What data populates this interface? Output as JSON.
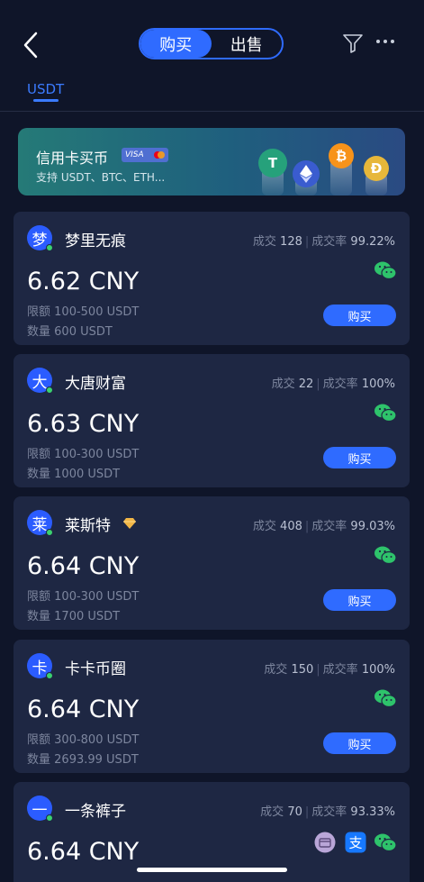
{
  "header": {
    "tabs": [
      {
        "label": "购买"
      },
      {
        "label": "出售"
      }
    ],
    "active_tab": 0
  },
  "asset_tabs": [
    {
      "label": "USDT"
    }
  ],
  "banner": {
    "title": "信用卡买币",
    "card_badge": "VISA",
    "subtitle": "支持 USDT、BTC、ETH...",
    "coins": [
      {
        "icon": "tether-icon",
        "color": "#26a17b"
      },
      {
        "icon": "ethereum-icon",
        "color": "#3a5ccf"
      },
      {
        "icon": "bitcoin-icon",
        "color": "#f7931a"
      },
      {
        "icon": "dogecoin-icon",
        "color": "#e7b73a"
      }
    ]
  },
  "labels": {
    "trades": "成交",
    "rate": "成交率",
    "limit": "限额",
    "quantity": "数量",
    "buy": "购买"
  },
  "merchants": [
    {
      "avatar": "梦",
      "name": "梦里无痕",
      "trades": "128",
      "rate": "99.22%",
      "price": "6.62 CNY",
      "limit": "100-500 USDT",
      "quantity": "600 USDT",
      "verified": false,
      "payments": [
        "wechat-pay-icon"
      ]
    },
    {
      "avatar": "大",
      "name": "大唐财富",
      "trades": "22",
      "rate": "100%",
      "price": "6.63 CNY",
      "limit": "100-300 USDT",
      "quantity": "1000 USDT",
      "verified": false,
      "payments": [
        "wechat-pay-icon"
      ]
    },
    {
      "avatar": "莱",
      "name": "莱斯特",
      "trades": "408",
      "rate": "99.03%",
      "price": "6.64 CNY",
      "limit": "100-300 USDT",
      "quantity": "1700 USDT",
      "verified": true,
      "payments": [
        "wechat-pay-icon"
      ]
    },
    {
      "avatar": "卡",
      "name": "卡卡币圈",
      "trades": "150",
      "rate": "100%",
      "price": "6.64 CNY",
      "limit": "300-800 USDT",
      "quantity": "2693.99 USDT",
      "verified": false,
      "payments": [
        "wechat-pay-icon"
      ]
    },
    {
      "avatar": "一",
      "name": "一条裤子",
      "trades": "70",
      "rate": "93.33%",
      "price": "6.64 CNY",
      "limit": "",
      "quantity": "",
      "verified": false,
      "payments": [
        "bank-card-icon",
        "alipay-icon",
        "wechat-pay-icon"
      ]
    }
  ]
}
